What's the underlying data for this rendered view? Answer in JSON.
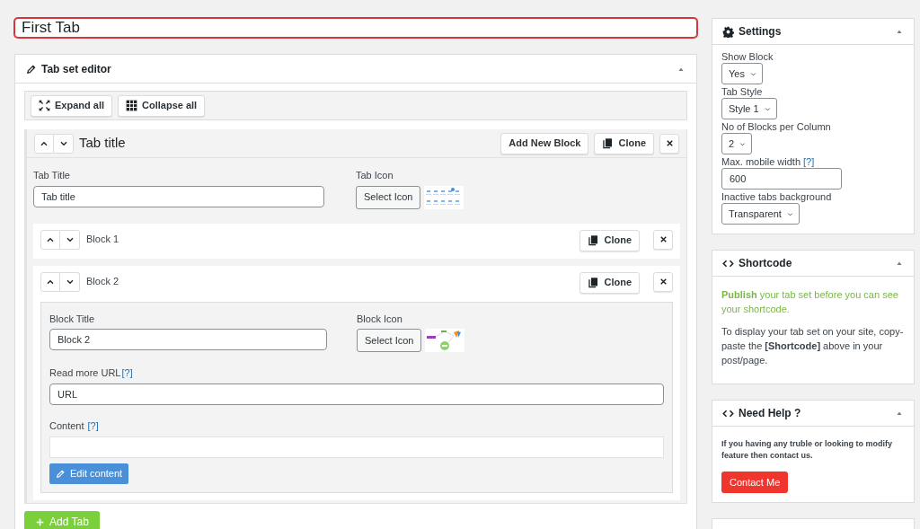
{
  "title_field": {
    "value": "First Tab"
  },
  "editor": {
    "title": "Tab set editor",
    "toolbar": [
      {
        "kind": "expand",
        "label": "Expand all"
      },
      {
        "kind": "collapse",
        "label": "Collapse all"
      }
    ],
    "tab": {
      "heading": "Tab title",
      "add_block": "Add New Block",
      "clone": "Clone",
      "title_label": "Tab Title",
      "title_value": "Tab title",
      "icon_label": "Tab Icon",
      "icon_button": "Select Icon",
      "blocks": [
        {
          "title": "Block 1",
          "expanded": false,
          "clone": "Clone"
        },
        {
          "title": "Block 2",
          "expanded": true,
          "clone": "Clone",
          "title_label": "Block Title",
          "title_value": "Block 2",
          "icon_label": "Block Icon",
          "icon_button": "Select Icon",
          "url_label": "Read more URL",
          "url_help": "[?]",
          "url_value": "URL",
          "content_label": "Content",
          "content_help": "[?]",
          "edit_button": "Edit content"
        }
      ]
    },
    "add_tab": "Add Tab"
  },
  "settings": {
    "title": "Settings",
    "fields": [
      {
        "label": "Show Block",
        "kind": "select",
        "value": "Yes"
      },
      {
        "label": "Tab Style",
        "kind": "select",
        "value": "Style 1"
      },
      {
        "label": "No of Blocks per Column",
        "kind": "select",
        "value": "2"
      },
      {
        "label": "Max. mobile width",
        "help": "[?]",
        "kind": "input",
        "value": "600"
      },
      {
        "label": "Inactive tabs background",
        "kind": "select",
        "value": "Transparent"
      }
    ]
  },
  "shortcode": {
    "title": "Shortcode",
    "notice": "**Publish** your tab set before you can see your shortcode.",
    "text": "To display your tab set on your site, copy-paste the **[Shortcode]** above in your post/page."
  },
  "help": {
    "title": "Need Help ?",
    "text": "If you having any truble or looking to modify feature then contact us.",
    "button": "Contact Me"
  }
}
